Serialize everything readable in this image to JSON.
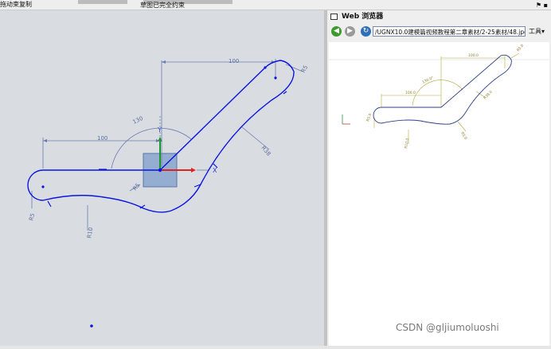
{
  "toolbar": {
    "left_label": "拖动束复制",
    "status": "草图已完全约束"
  },
  "sketch": {
    "dims": {
      "d_top": "100",
      "d_left": "100",
      "angle": "130",
      "r_top": "R5",
      "r_mid": "R38",
      "r_left": "R5",
      "r_bottom": "R10",
      "r_small": "R5"
    },
    "axis_x": "X",
    "axis_y": "Y"
  },
  "browser": {
    "title": "Web 浏览器",
    "url": "/UGNX10.0建模篇视频教程第二章素材/2-25素材/48.jpg",
    "tools_label": "工具",
    "image_dims": {
      "d1": "100.0",
      "d2": "100.0",
      "angle": "130.0°",
      "r1": "R5.0",
      "r2": "R38.0",
      "r3": "R5.0",
      "r4": "R10.0",
      "r5": "R5.0"
    }
  },
  "watermark": "CSDN @gljiumoluoshi",
  "colors": {
    "sketch_curve": "#0a14e0",
    "dim_line": "#6a7cae",
    "image_curve": "#2d3f86",
    "image_dim": "#b2aa3a",
    "canvas_bg": "#d9dde2",
    "datum_plane": "#7e9cc9"
  }
}
